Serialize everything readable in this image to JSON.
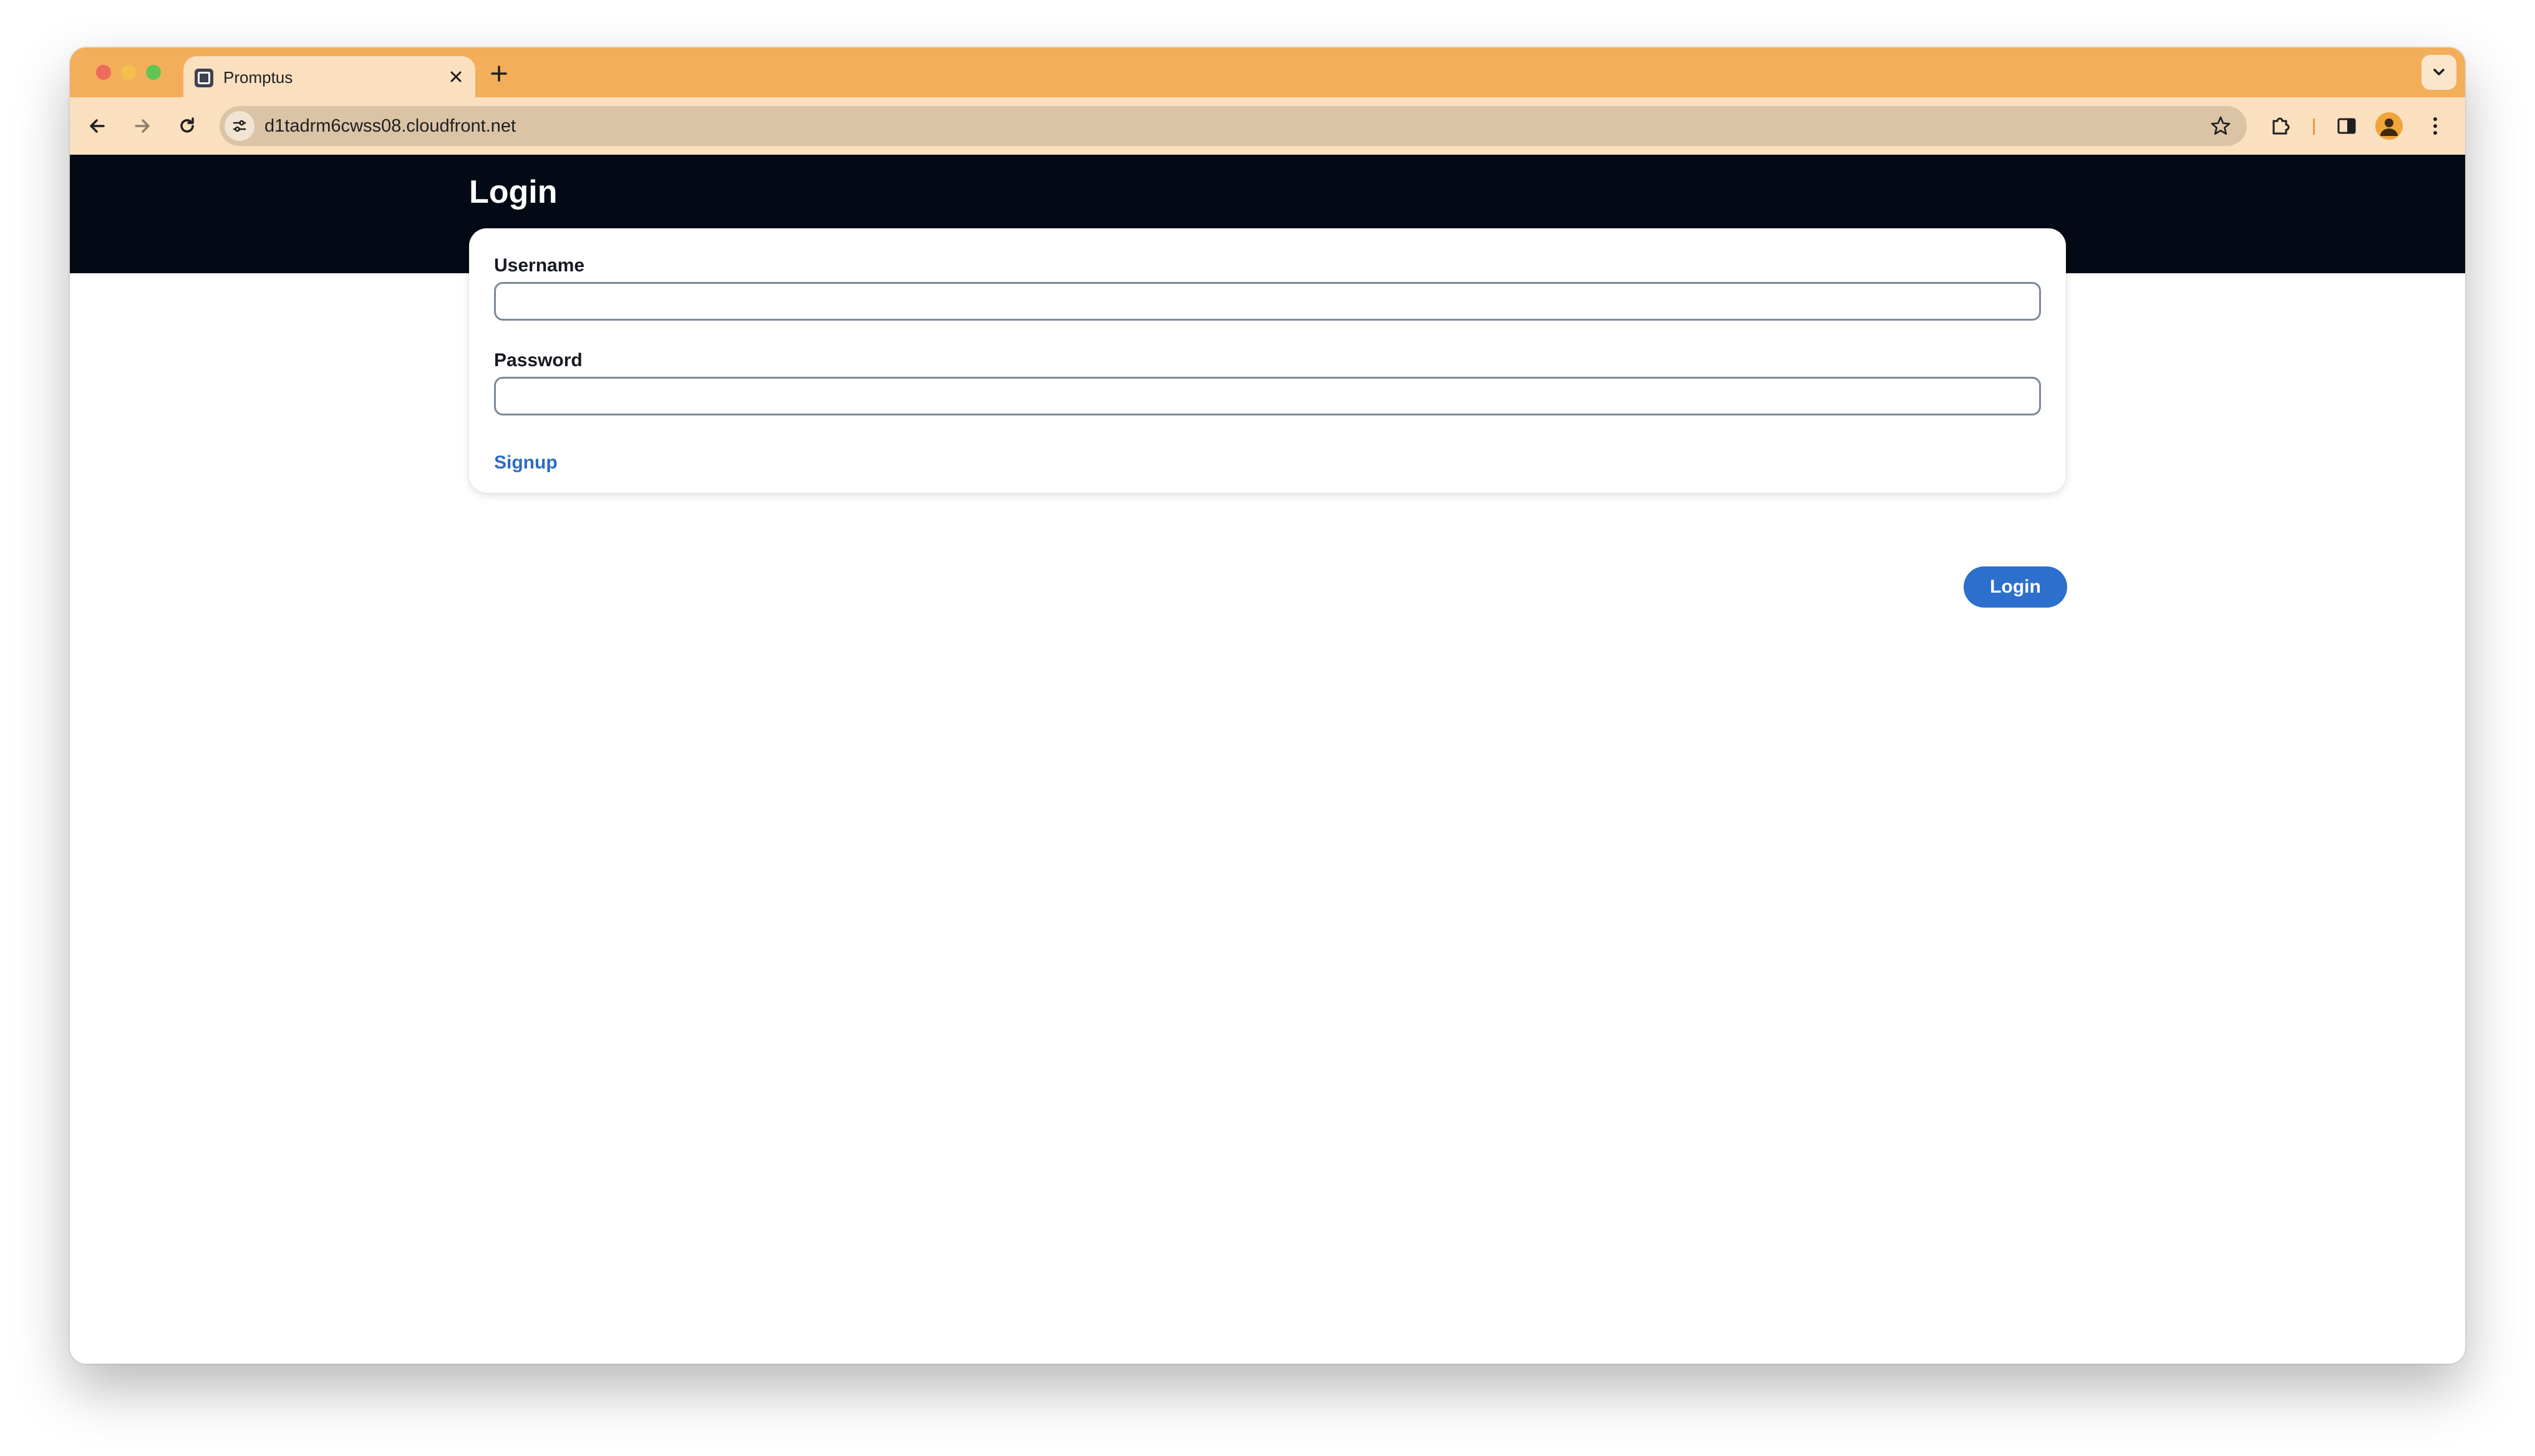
{
  "browser": {
    "tab_title": "Promptus",
    "url": "d1tadrm6cwss08.cloudfront.net",
    "icons": {
      "back": "arrow-left-icon",
      "forward": "arrow-right-icon",
      "reload": "reload-icon",
      "site_info": "tune-icon",
      "bookmark": "star-icon",
      "extensions": "puzzle-icon",
      "side_panel": "side-panel-icon",
      "profile": "avatar-icon",
      "menu": "kebab-menu-icon",
      "new_tab": "plus-icon",
      "tab_close": "close-icon",
      "tab_search": "chevron-down-icon"
    },
    "colors": {
      "tab_strip": "#f3ae5a",
      "toolbar": "#fbe0bf",
      "omnibox": "#dbc4a6"
    }
  },
  "page": {
    "title": "Login",
    "form": {
      "username_label": "Username",
      "username_value": "",
      "password_label": "Password",
      "password_value": "",
      "signup_link": "Signup"
    },
    "login_button": "Login",
    "colors": {
      "header": "#040a15",
      "accent": "#2d6fcc"
    }
  }
}
